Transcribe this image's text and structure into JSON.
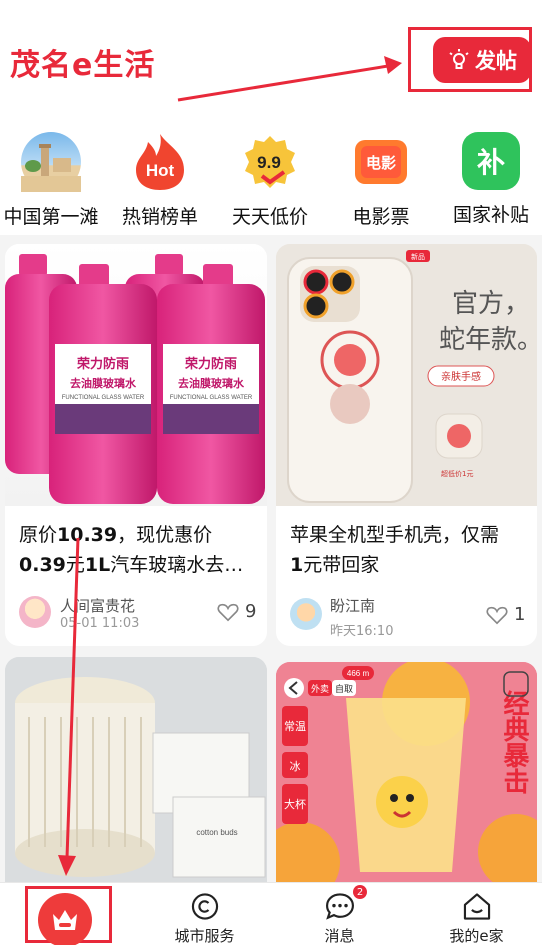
{
  "header": {
    "app_title": "茂名e生活",
    "post_button_label": "发帖"
  },
  "categories": [
    {
      "label": "中国第一滩",
      "icon": "beach-landmark-icon"
    },
    {
      "label": "热销榜单",
      "icon": "hot-flame-icon",
      "icon_text": "Hot"
    },
    {
      "label": "天天低价",
      "icon": "price-tag-icon",
      "icon_text": "9.9"
    },
    {
      "label": "电影票",
      "icon": "movie-ticket-icon",
      "icon_text": "电影"
    },
    {
      "label": "国家补贴",
      "icon": "subsidy-icon",
      "icon_text": "补"
    }
  ],
  "feed": [
    {
      "title_parts": [
        "原价",
        "10.39",
        "，现优惠价",
        "0.39",
        "元",
        "1L",
        "汽车玻璃水去…"
      ],
      "image_text": {
        "brand": "荣力防雨",
        "line2": "去油膜玻璃水",
        "line3": "FUNCTIONAL GLASS WATER"
      },
      "author": "人间富贵花",
      "time": "05-01 11:03",
      "likes": "9"
    },
    {
      "title_parts": [
        "苹果全机型手机壳，仅需",
        "1",
        "元带回家"
      ],
      "image_text": {
        "tag": "新品",
        "slogan_1": "官方，",
        "slogan_2": "蛇年款。",
        "pill": "亲肤手感",
        "price_note": "超低价1元"
      },
      "author": "盼江南",
      "time": "昨天16:10",
      "likes": "1"
    },
    {
      "image_text": {
        "pack": "cotton buds"
      }
    },
    {
      "image_text": {
        "tag_takeout": "外卖",
        "tag_pickup": "自取",
        "distance": "466 m",
        "vertical_1": "常温",
        "vertical_2": "冰",
        "vertical_3": "大杯",
        "big_text": "经典暴击"
      }
    }
  ],
  "tabbar": {
    "tabs": [
      {
        "label": "",
        "icon": "crown-home-icon"
      },
      {
        "label": "城市服务",
        "icon": "city-service-icon"
      },
      {
        "label": "消息",
        "icon": "message-icon",
        "badge": "2"
      },
      {
        "label": "我的e家",
        "icon": "my-home-icon"
      }
    ]
  },
  "colors": {
    "accent": "#e8293a",
    "text": "#111111",
    "muted": "#999999"
  }
}
